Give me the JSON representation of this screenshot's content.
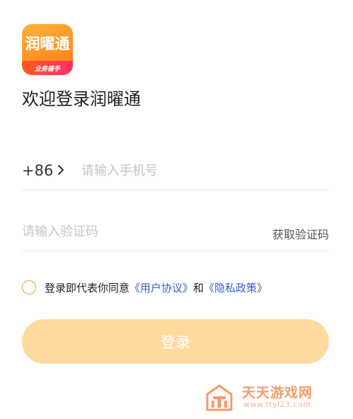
{
  "app": {
    "logo_text": "润曜通",
    "logo_subtitle": "业务循手",
    "welcome": "欢迎登录润曜通"
  },
  "login": {
    "country_code": "+86",
    "phone_placeholder": "请输入手机号",
    "code_placeholder": "请输入验证码",
    "get_code_label": "获取验证码",
    "agree_prefix": "登录即代表你同意",
    "user_agreement_link": "《用户协议》",
    "agree_and": "和",
    "privacy_policy_link": "《隐私政策》",
    "login_button": "登录"
  },
  "watermark": {
    "title": "天天游戏网",
    "url": "www.ttyl23.com"
  },
  "colors": {
    "primary_disabled": "#fedb9c",
    "link": "#3a5ec4",
    "checkbox_border": "#f0a030",
    "logo_orange": "#ff8a1f"
  },
  "icons": {
    "country_selector": "chevron-right-icon",
    "agreement_checkbox": "circle-checkbox-icon",
    "watermark_logo": "house-logo-icon"
  }
}
